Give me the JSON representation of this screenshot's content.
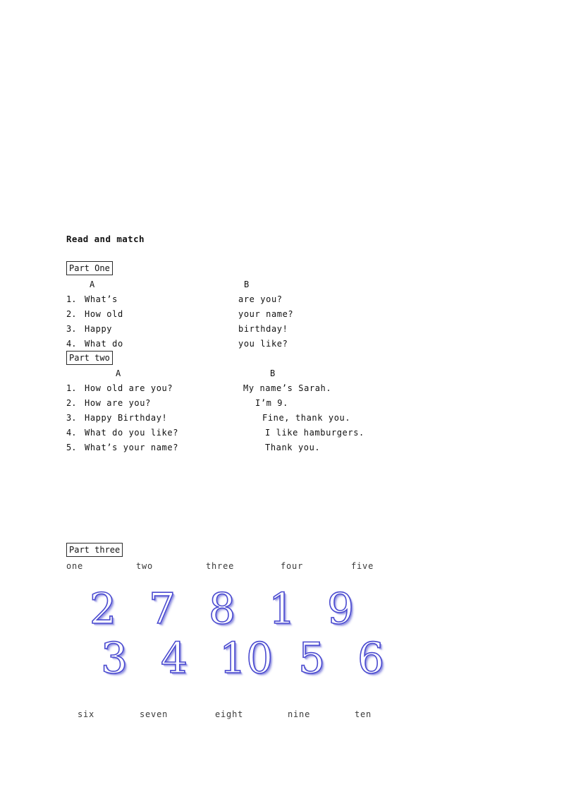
{
  "document": {
    "heading": "Read and match"
  },
  "part_one": {
    "label": "Part One",
    "col_a_head": "A",
    "col_b_head": "B",
    "column_a": [
      {
        "num": "1.",
        "text": "What’s"
      },
      {
        "num": "2.",
        "text": "How old"
      },
      {
        "num": "3.",
        "text": "Happy"
      },
      {
        "num": "4.",
        "text": "What do"
      }
    ],
    "column_b": [
      "are you?",
      "your name?",
      "birthday!",
      "you like?"
    ]
  },
  "part_two": {
    "label": "Part two",
    "col_a_head": "A",
    "col_b_head": "B",
    "column_a": [
      {
        "num": "1.",
        "text": "How old are you?"
      },
      {
        "num": "2.",
        "text": "How are you?"
      },
      {
        "num": "3.",
        "text": "Happy Birthday!"
      },
      {
        "num": "4.",
        "text": "What do you like?"
      },
      {
        "num": "5.",
        "text": "What’s your name?"
      }
    ],
    "column_b": [
      "My name’s Sarah.",
      "I’m 9.",
      "Fine, thank you.",
      "I like hamburgers.",
      "Thank you."
    ]
  },
  "part_three": {
    "label": "Part three",
    "words_top": [
      "one",
      "two",
      "three",
      "four",
      "five"
    ],
    "words_bottom": [
      "six",
      "seven",
      "eight",
      "nine",
      "ten"
    ],
    "digits_row_one": [
      "2",
      "7",
      "8",
      "1",
      "9"
    ],
    "digits_row_two": [
      "3",
      "4",
      "10",
      "5",
      "6"
    ],
    "digit_color": "#4a4ad0",
    "digit_shadow_color": "#9696e1"
  }
}
